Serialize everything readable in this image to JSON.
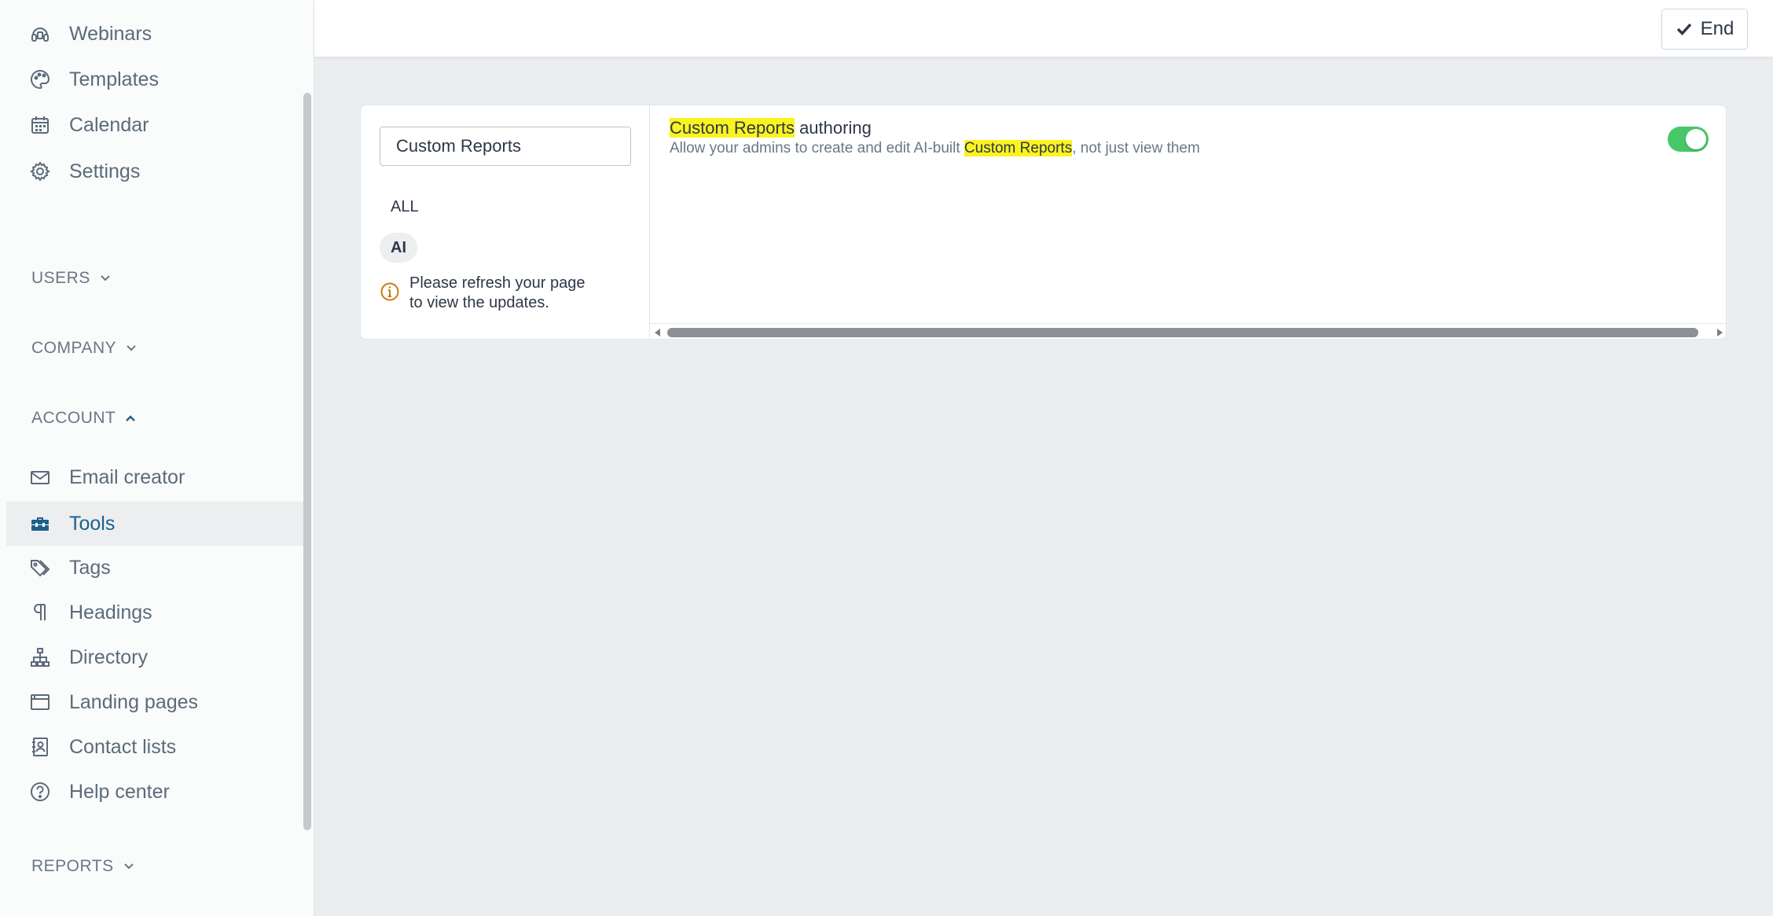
{
  "sidebar": {
    "top_items": [
      {
        "label": "Webinars",
        "icon": "webinar-icon"
      },
      {
        "label": "Templates",
        "icon": "palette-icon"
      },
      {
        "label": "Calendar",
        "icon": "calendar-icon"
      },
      {
        "label": "Settings",
        "icon": "gear-icon"
      }
    ],
    "sections": {
      "users": "USERS",
      "company": "COMPANY",
      "account": "ACCOUNT",
      "reports": "REPORTS"
    },
    "account_items": [
      {
        "label": "Email creator",
        "icon": "envelope-icon"
      },
      {
        "label": "Tools",
        "icon": "toolbox-icon",
        "active": true
      },
      {
        "label": "Tags",
        "icon": "tags-icon"
      },
      {
        "label": "Headings",
        "icon": "paragraph-icon"
      },
      {
        "label": "Directory",
        "icon": "sitemap-icon"
      },
      {
        "label": "Landing pages",
        "icon": "browser-window-icon"
      },
      {
        "label": "Contact lists",
        "icon": "contact-book-icon"
      },
      {
        "label": "Help center",
        "icon": "question-circle-icon"
      }
    ]
  },
  "topbar": {
    "end_label": "End"
  },
  "tools": {
    "search_value": "Custom Reports",
    "filters": {
      "all": "ALL",
      "ai": "AI"
    },
    "refresh_note": "Please refresh your page\nto view the updates.",
    "setting": {
      "title_highlight": "Custom Reports",
      "title_rest": " authoring",
      "desc_before": "Allow your admins to create and edit AI-built ",
      "desc_highlight": "Custom Reports",
      "desc_after": ", not just view them",
      "enabled": true
    }
  },
  "colors": {
    "accent": "#1f5f8b",
    "toggle_on": "#48c76a",
    "highlight": "#fbf321",
    "warning_icon": "#c77b12"
  }
}
